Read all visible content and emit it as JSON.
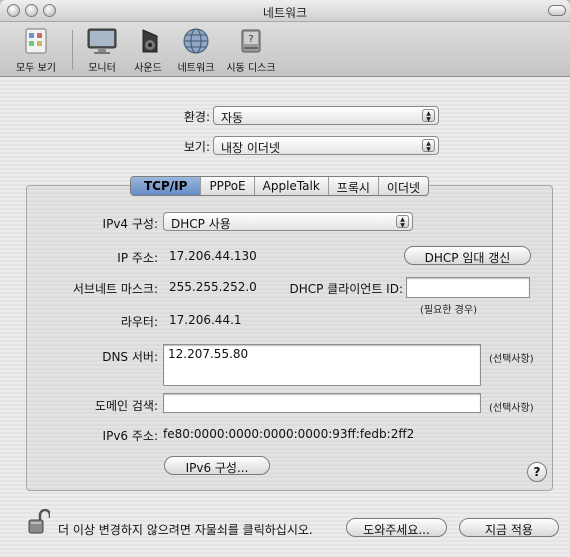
{
  "window": {
    "title": "네트워크"
  },
  "toolbar": {
    "show_all": "모두 보기",
    "items": [
      "모니터",
      "사운드",
      "네트워크",
      "시동 디스크"
    ]
  },
  "location": {
    "label": "환경:",
    "value": "자동"
  },
  "show": {
    "label": "보기:",
    "value": "내장 이더넷"
  },
  "tabs": [
    "TCP/IP",
    "PPPoE",
    "AppleTalk",
    "프록시",
    "이더넷"
  ],
  "tcpip": {
    "ipv4_label": "IPv4 구성:",
    "ipv4_value": "DHCP 사용",
    "ip_label": "IP 주소:",
    "ip_value": "17.206.44.130",
    "renew_button": "DHCP 임대 갱신",
    "subnet_label": "서브네트 마스크:",
    "subnet_value": "255.255.252.0",
    "client_id_label": "DHCP 클라이언트 ID:",
    "client_id_value": "",
    "client_id_note": "(필요한 경우)",
    "router_label": "라우터:",
    "router_value": "17.206.44.1",
    "dns_label": "DNS 서버:",
    "dns_value": "12.207.55.80",
    "dns_note": "(선택사항)",
    "search_label": "도메인 검색:",
    "search_value": "",
    "search_note": "(선택사항)",
    "ipv6_label": "IPv6 주소:",
    "ipv6_value": "fe80:0000:0000:0000:0000:93ff:fedb:2ff2",
    "ipv6_button": "IPv6 구성...",
    "help": "?"
  },
  "footer": {
    "lock_text": "더 이상 변경하지 않으려면 자물쇠를 클릭하십시오.",
    "assist_button": "도와주세요...",
    "apply_button": "지금 적용"
  }
}
